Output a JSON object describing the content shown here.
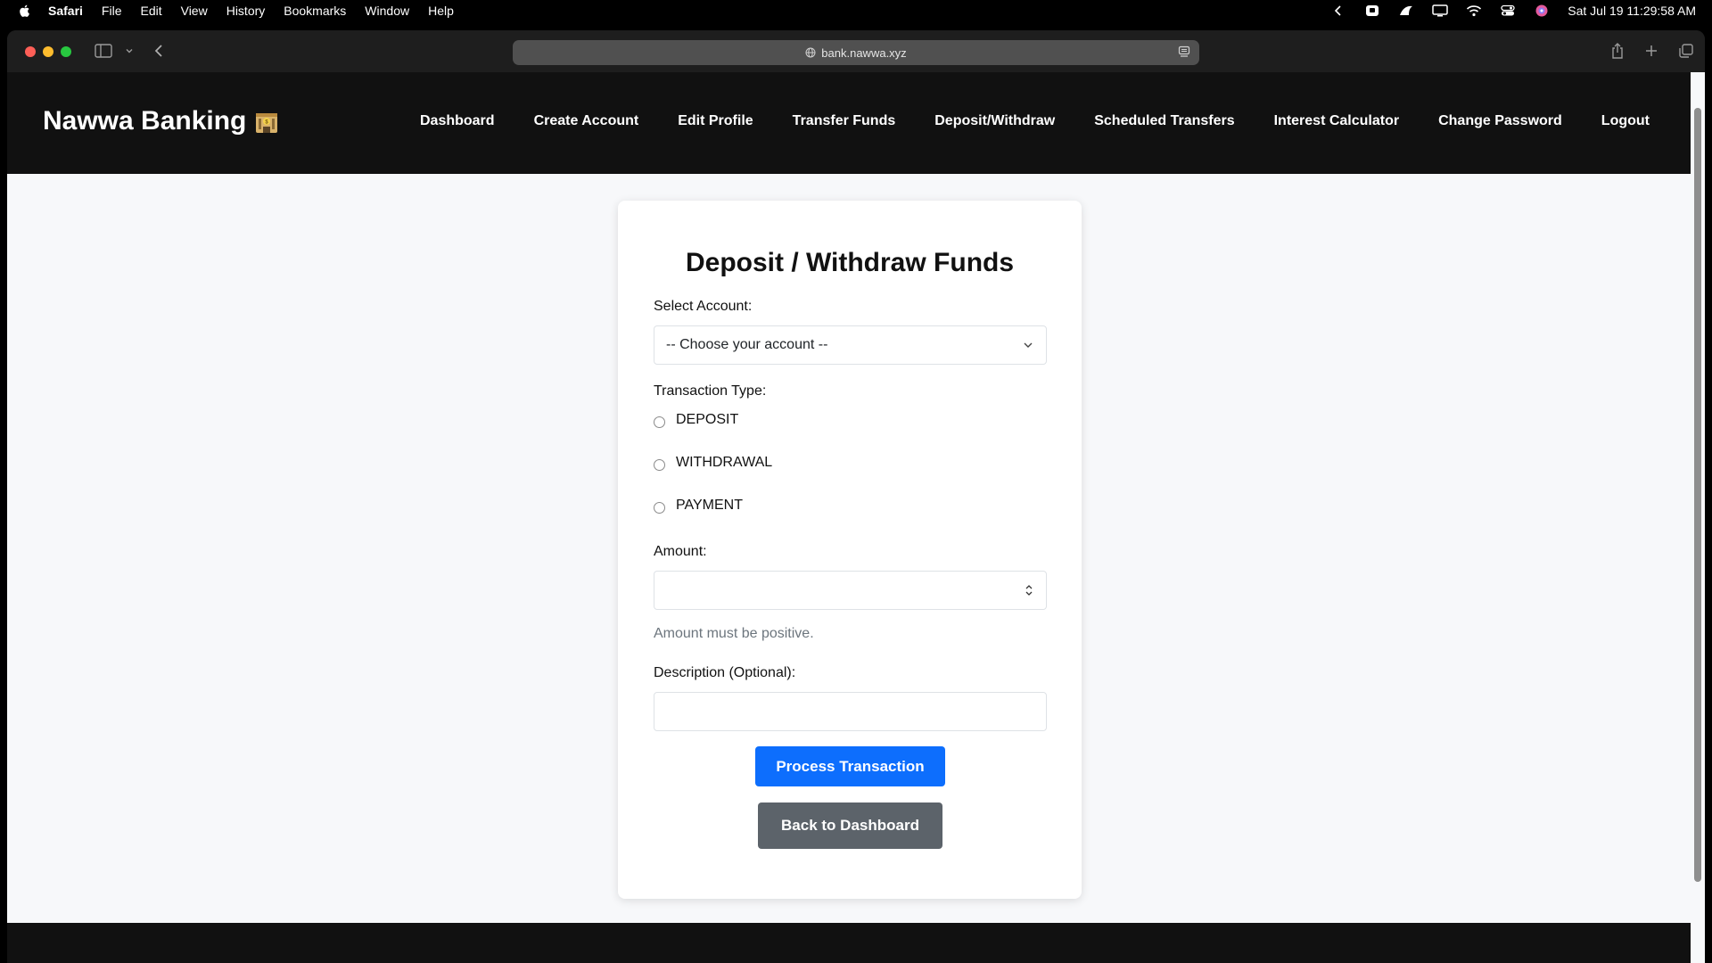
{
  "menubar": {
    "app": "Safari",
    "items": [
      "File",
      "Edit",
      "View",
      "History",
      "Bookmarks",
      "Window",
      "Help"
    ],
    "clock": "Sat Jul 19  11:29:58 AM"
  },
  "browser": {
    "url": "bank.nawwa.xyz"
  },
  "site": {
    "brand": "Nawwa Banking",
    "nav": [
      "Dashboard",
      "Create Account",
      "Edit Profile",
      "Transfer Funds",
      "Deposit/Withdraw",
      "Scheduled Transfers",
      "Interest Calculator",
      "Change Password",
      "Logout"
    ]
  },
  "form": {
    "title": "Deposit / Withdraw Funds",
    "account_label": "Select Account:",
    "account_value": "-- Choose your account --",
    "type_label": "Transaction Type:",
    "types": [
      "DEPOSIT",
      "WITHDRAWAL",
      "PAYMENT"
    ],
    "amount_label": "Amount:",
    "amount_value": "",
    "amount_help": "Amount must be positive.",
    "description_label": "Description (Optional):",
    "description_value": "",
    "submit_label": "Process Transaction",
    "back_label": "Back to Dashboard"
  },
  "colors": {
    "primary": "#0d6efd",
    "secondary": "#5c636a",
    "header_bg": "#111111"
  }
}
